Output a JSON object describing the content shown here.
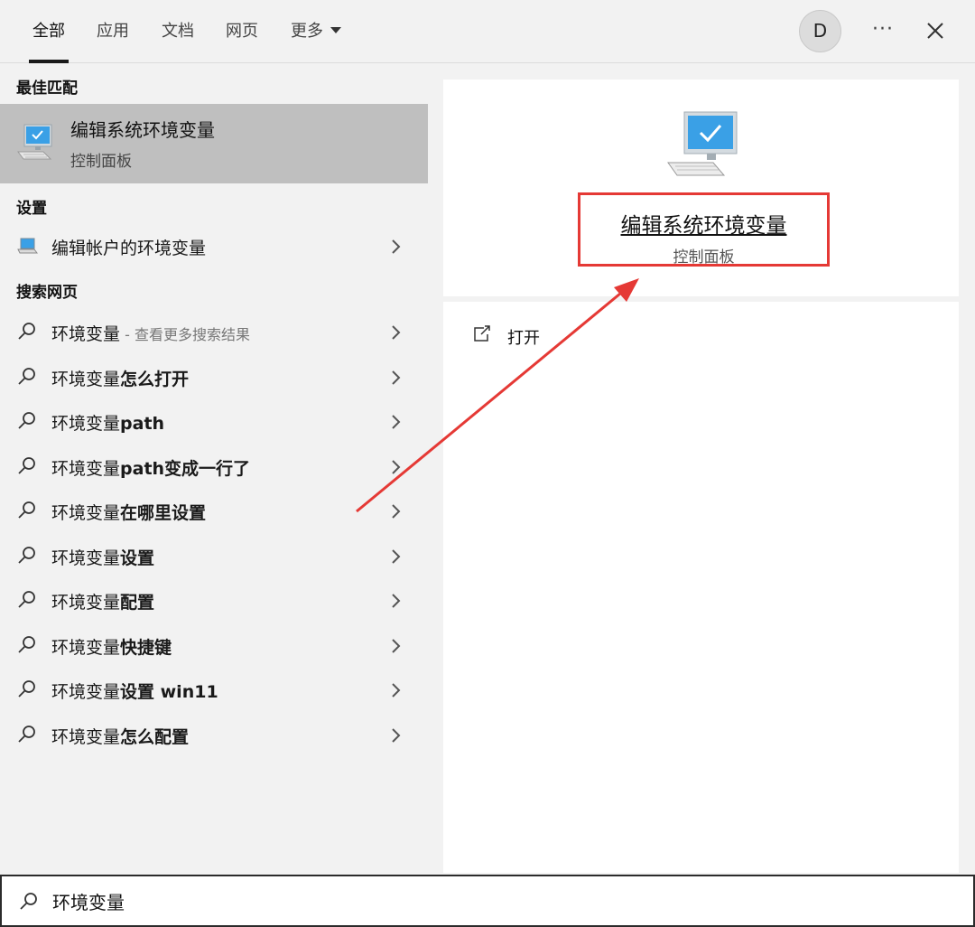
{
  "tabs": [
    {
      "label": "全部",
      "active": true
    },
    {
      "label": "应用"
    },
    {
      "label": "文档"
    },
    {
      "label": "网页"
    },
    {
      "label": "更多"
    }
  ],
  "avatar_letter": "D",
  "more_label": "···",
  "sections": {
    "best_match": "最佳匹配",
    "settings": "设置",
    "web_search": "搜索网页"
  },
  "best_match": {
    "title": "编辑系统环境变量",
    "subtitle": "控制面板"
  },
  "settings_item": {
    "label": "编辑帐户的环境变量"
  },
  "web_results": [
    {
      "prefix": "环境变量",
      "bold": "",
      "hint": " - 查看更多搜索结果"
    },
    {
      "prefix": "环境变量",
      "bold": "怎么打开",
      "hint": ""
    },
    {
      "prefix": "环境变量",
      "bold": "path",
      "hint": ""
    },
    {
      "prefix": "环境变量",
      "bold": "path变成一行了",
      "hint": ""
    },
    {
      "prefix": "环境变量",
      "bold": "在哪里设置",
      "hint": ""
    },
    {
      "prefix": "环境变量",
      "bold": "设置",
      "hint": ""
    },
    {
      "prefix": "环境变量",
      "bold": "配置",
      "hint": ""
    },
    {
      "prefix": "环境变量",
      "bold": "快捷键",
      "hint": ""
    },
    {
      "prefix": "环境变量",
      "bold": "设置 win11",
      "hint": ""
    },
    {
      "prefix": "环境变量",
      "bold": "怎么配置",
      "hint": ""
    }
  ],
  "preview": {
    "title": "编辑系统环境变量",
    "subtitle": "控制面板",
    "action_open": "打开"
  },
  "search": {
    "value": "环境变量"
  },
  "colors": {
    "highlight_box": "#e53935",
    "arrow": "#e53935",
    "monitor_screen": "#3aa0e6",
    "selected_row": "#bfbfbf"
  }
}
